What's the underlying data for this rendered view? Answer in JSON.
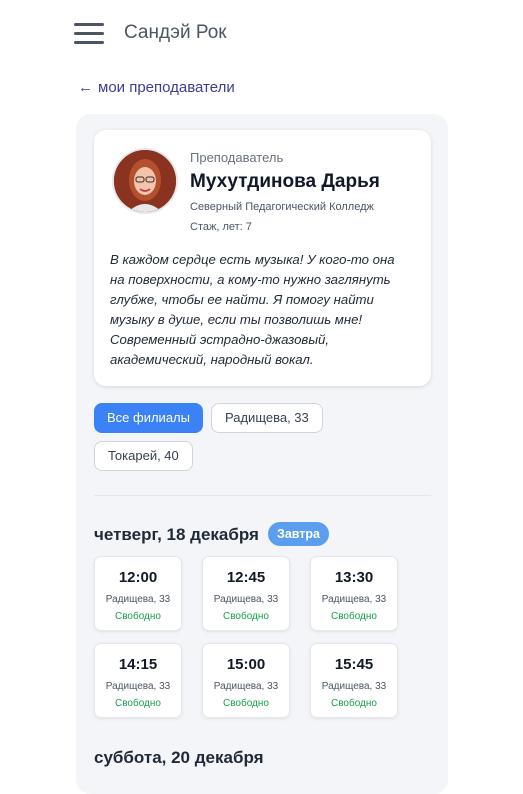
{
  "app": {
    "title": "Сандэй Рок"
  },
  "nav": {
    "back_label": "мои преподаватели"
  },
  "teacher": {
    "role": "Преподаватель",
    "name": "Мухутдинова Дарья",
    "college": "Северный Педагогический Колледж",
    "experience": "Стаж, лет: 7",
    "bio_lines": [
      "В каждом сердце есть музыка! У кого-то она",
      "на поверхности, а кому-то нужно заглянуть",
      "глубже, чтобы ее найти. Я помогу найти",
      "музыку в душе, если ты позволишь мне!",
      "Современный эстрадно-джазовый,",
      "академический, народный вокал."
    ]
  },
  "filters": [
    {
      "label": "Все филиалы",
      "active": true
    },
    {
      "label": "Радищева, 33",
      "active": false
    },
    {
      "label": "Токарей, 40",
      "active": false
    }
  ],
  "schedule": [
    {
      "day": "четверг, 18 декабря",
      "badge": "Завтра",
      "slots": [
        {
          "time": "12:00",
          "address": "Радищева, 33",
          "status": "Свободно"
        },
        {
          "time": "12:45",
          "address": "Радищева, 33",
          "status": "Свободно"
        },
        {
          "time": "13:30",
          "address": "Радищева, 33",
          "status": "Свободно"
        },
        {
          "time": "14:15",
          "address": "Радищева, 33",
          "status": "Свободно"
        },
        {
          "time": "15:00",
          "address": "Радищева, 33",
          "status": "Свободно"
        },
        {
          "time": "15:45",
          "address": "Радищева, 33",
          "status": "Свободно"
        }
      ]
    },
    {
      "day": "суббота, 20 декабря"
    }
  ]
}
